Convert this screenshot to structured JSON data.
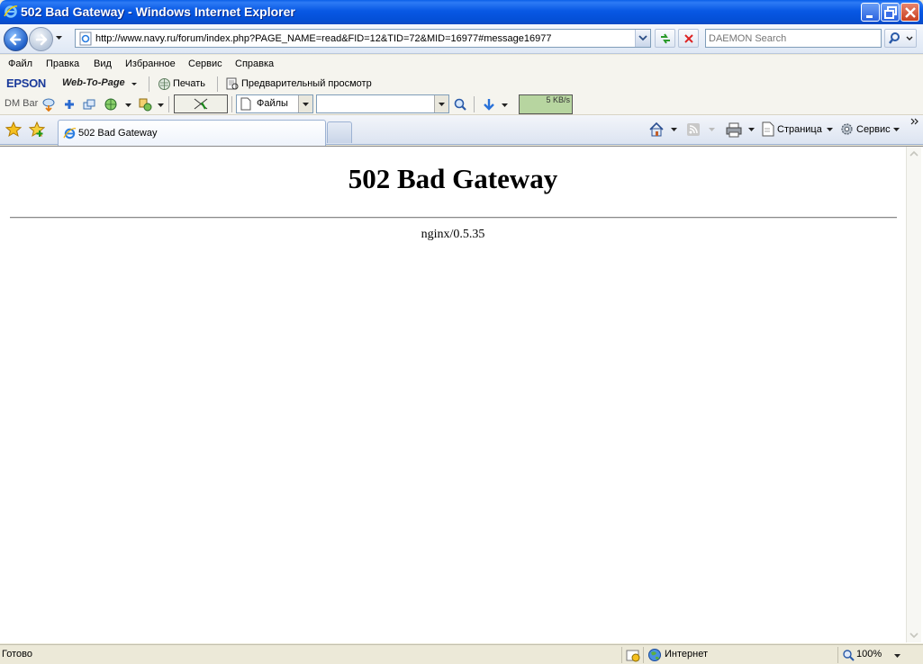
{
  "window": {
    "title": "502 Bad Gateway - Windows Internet Explorer"
  },
  "address": {
    "url": "http://www.navy.ru/forum/index.php?PAGE_NAME=read&FID=12&TID=72&MID=16977#message16977"
  },
  "search": {
    "placeholder": "DAEMON Search"
  },
  "menu": {
    "items": [
      "Файл",
      "Правка",
      "Вид",
      "Избранное",
      "Сервис",
      "Справка"
    ]
  },
  "epson_bar": {
    "brand": "EPSON",
    "web_to_page": "Web-To-Page",
    "print_label": "Печать",
    "preview_label": "Предварительный просмотр"
  },
  "dm_bar": {
    "label": "DM Bar",
    "files_label": "Файлы",
    "speed": "5 KB/s"
  },
  "tabs": [
    {
      "label": "502 Bad Gateway"
    }
  ],
  "command_bar": {
    "page_label": "Страница",
    "tools_label": "Сервис"
  },
  "page": {
    "heading": "502 Bad Gateway",
    "server": "nginx/0.5.35"
  },
  "status": {
    "text": "Готово",
    "zone": "Интернет",
    "zoom": "100%"
  }
}
